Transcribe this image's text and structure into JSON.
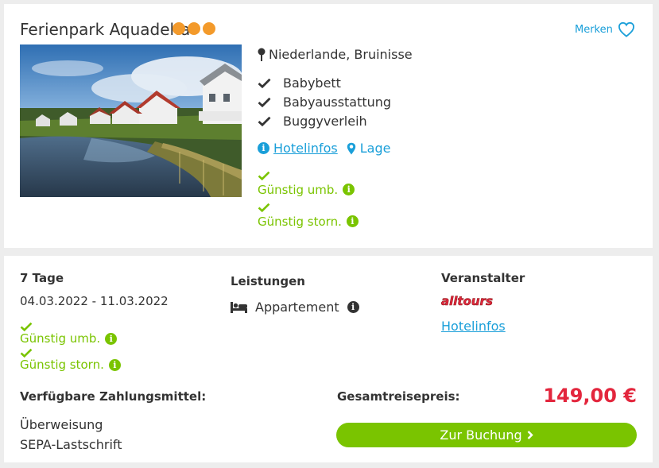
{
  "hotel": {
    "name": "Ferienpark Aquadelta",
    "rating_count": 3,
    "save_label": "Merken",
    "location": "Niederlande, Bruinisse",
    "features": [
      "Babybett",
      "Babyausstattung",
      "Buggyverleih"
    ],
    "links": {
      "hotelinfos": "Hotelinfos",
      "lage": "Lage"
    },
    "conditions": {
      "rebooking": "Günstig umb.",
      "cancellation": "Günstig storn."
    }
  },
  "offer": {
    "duration": "7 Tage",
    "dates": "04.03.2022 - 11.03.2022",
    "conditions": {
      "rebooking": "Günstig umb.",
      "cancellation": "Günstig storn."
    },
    "services": {
      "heading": "Leistungen",
      "room": "Appartement"
    },
    "operator": {
      "heading": "Veranstalter",
      "logo_text": "alltours",
      "link": "Hotelinfos"
    },
    "payment": {
      "heading": "Verfügbare Zahlungsmittel:",
      "methods": [
        "Überweisung",
        "SEPA-Lastschrift"
      ]
    },
    "total": {
      "heading": "Gesamtreisepreis:",
      "price": "149,00 €"
    },
    "book_label": "Zur Buchung"
  },
  "colors": {
    "accent_blue": "#1a9fd9",
    "green": "#7ac400",
    "price_red": "#e3263d",
    "star_orange": "#f39a2b"
  },
  "icons": [
    "rating-dot-icon",
    "heart-icon",
    "map-pin-icon",
    "check-icon",
    "info-icon",
    "location-marker-icon",
    "bed-icon",
    "chevron-right-icon"
  ]
}
